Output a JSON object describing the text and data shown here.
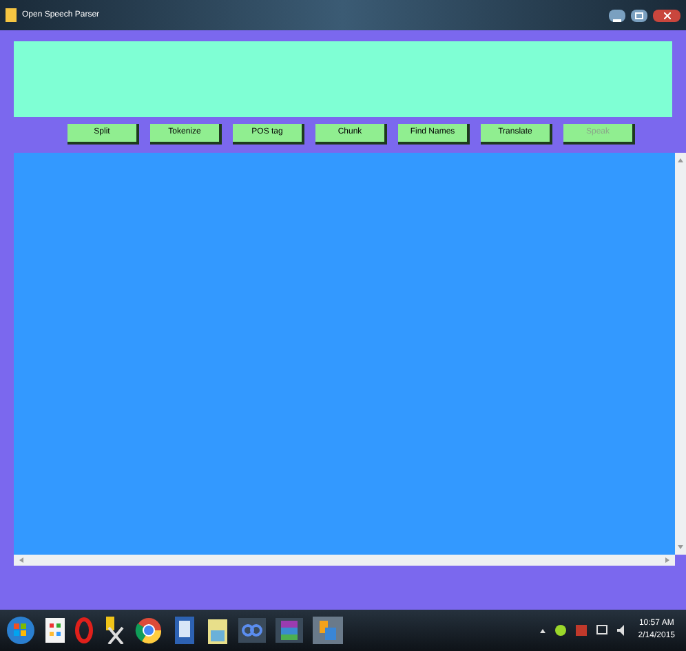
{
  "window": {
    "title": "Open Speech Parser"
  },
  "buttons": [
    {
      "label": "Split",
      "disabled": false
    },
    {
      "label": "Tokenize",
      "disabled": false
    },
    {
      "label": "POS tag",
      "disabled": false
    },
    {
      "label": "Chunk",
      "disabled": false
    },
    {
      "label": "Find Names",
      "disabled": false
    },
    {
      "label": "Translate",
      "disabled": false
    },
    {
      "label": "Speak",
      "disabled": true
    }
  ],
  "taskbar": {
    "time": "10:57 AM",
    "date": "2/14/2015"
  }
}
